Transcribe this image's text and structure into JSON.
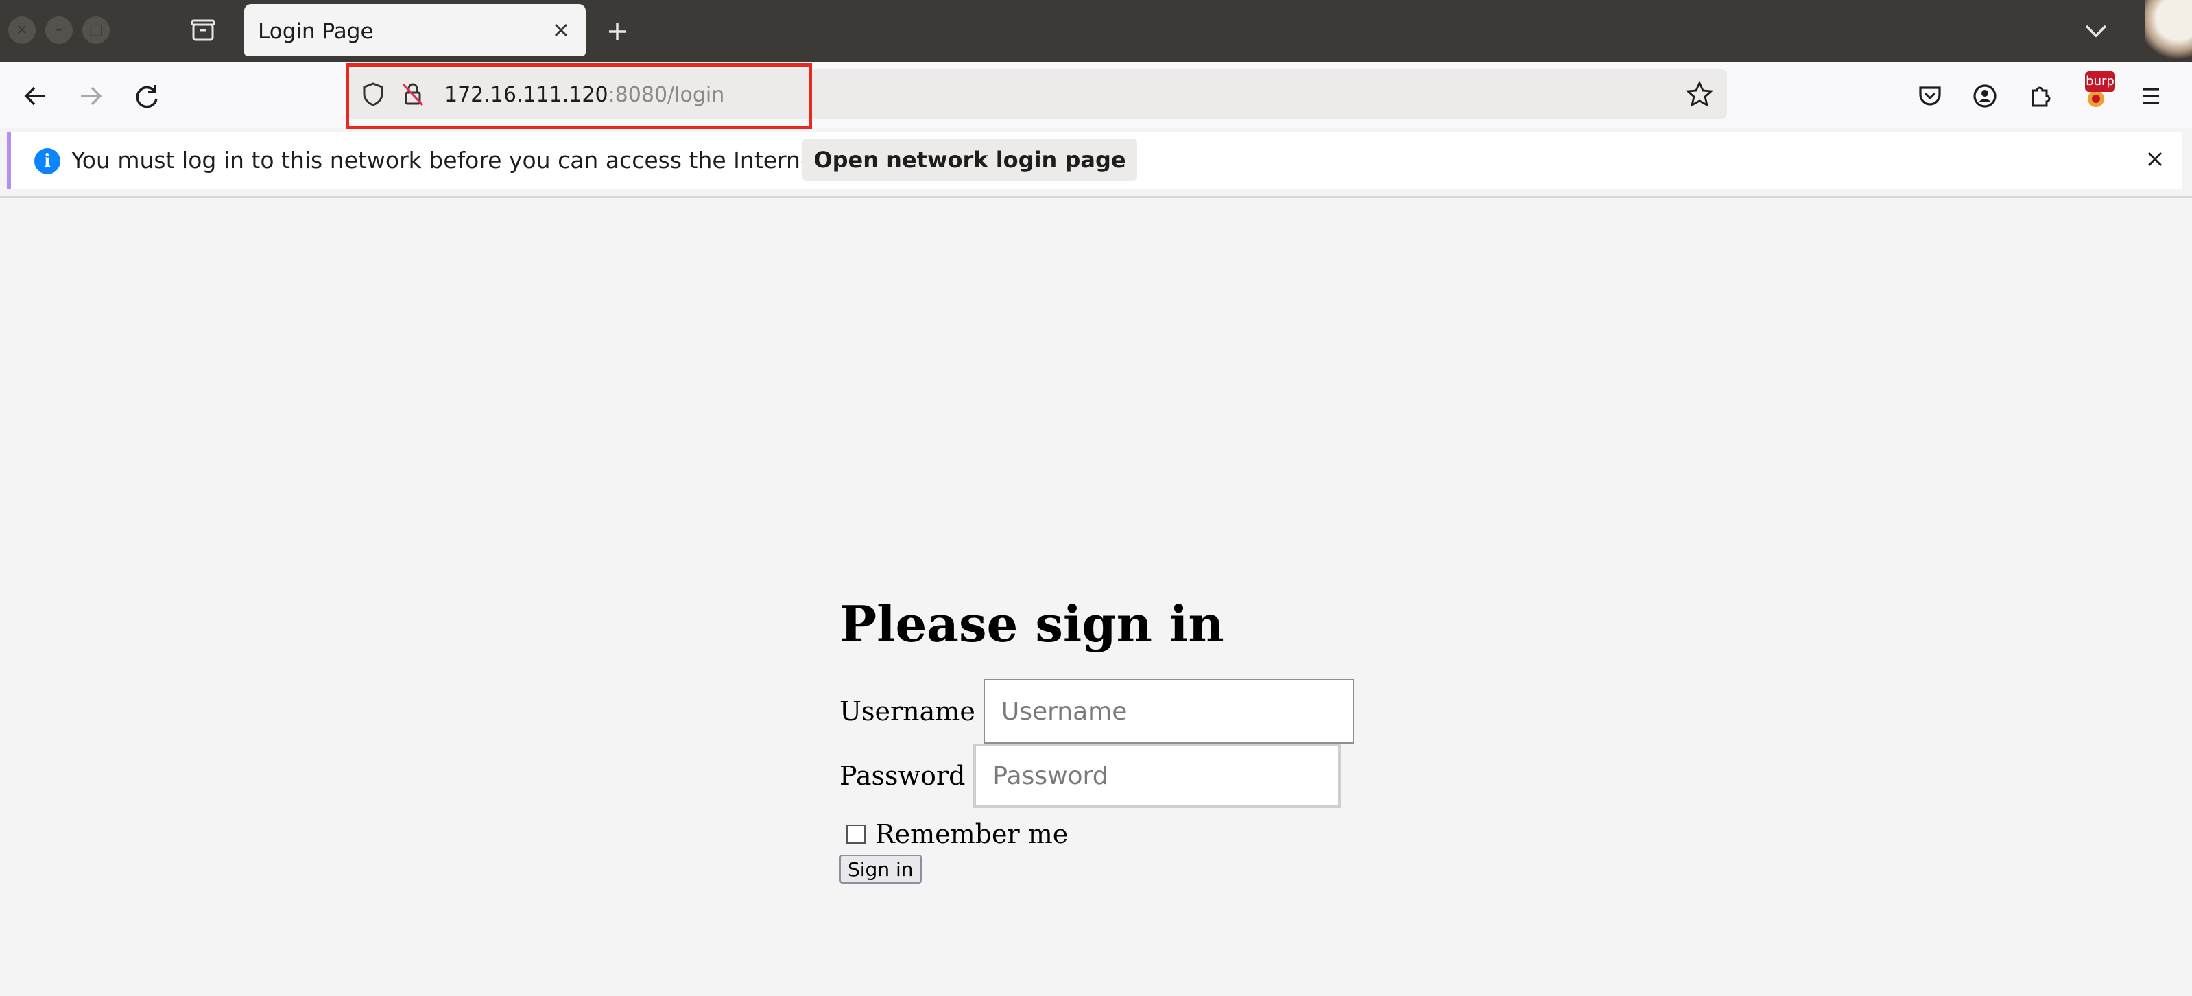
{
  "browser": {
    "tab_title": "Login Page",
    "url_host": "172.16.111.120",
    "url_rest": ":8080/login",
    "extension_badge": "burp"
  },
  "notification": {
    "message": "You must log in to this network before you can access the Internet.",
    "button_label": "Open network login page"
  },
  "login": {
    "heading": "Please sign in",
    "username_label": "Username",
    "username_placeholder": "Username",
    "password_label": "Password",
    "password_placeholder": "Password",
    "remember_label": "Remember me",
    "submit_label": "Sign in"
  },
  "colors": {
    "titlebar": "#3c3a37",
    "highlight": "#e8291e",
    "info_icon": "#0a84ff"
  }
}
